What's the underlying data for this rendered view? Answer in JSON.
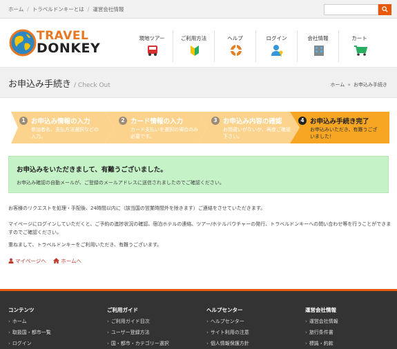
{
  "topbar": {
    "breadcrumbs": [
      "ホーム",
      "トラベルドンキーとは",
      "運営会社情報"
    ],
    "search_placeholder": ""
  },
  "logo": {
    "line1": "TRAVEL",
    "line2": "DONKEY"
  },
  "nav": {
    "items": [
      {
        "label": "現地ツアー",
        "icon": "bus-icon"
      },
      {
        "label": "ご利用方法",
        "icon": "beginner-mark-icon"
      },
      {
        "label": "ヘルプ",
        "icon": "lifebuoy-icon"
      },
      {
        "label": "ログイン",
        "icon": "user-key-icon"
      },
      {
        "label": "会社情報",
        "icon": "building-icon"
      },
      {
        "label": "カート",
        "icon": "cart-icon"
      }
    ]
  },
  "page": {
    "title": "お申込み手続き",
    "subtitle": "/ Check Out",
    "crumb_home": "ホーム",
    "crumb_current": "お申込み手続き"
  },
  "steps": [
    {
      "num": "1",
      "title": "お申込み情報の入力",
      "desc": "参加者名、支払方法選択などの入力。",
      "active": false
    },
    {
      "num": "2",
      "title": "カード情報の入力",
      "desc": "カード支払いを選択の場合のみ必要です。",
      "active": false
    },
    {
      "num": "3",
      "title": "お申込み内容の確認",
      "desc": "お間違いがないか、再度ご確認下さい。",
      "active": false
    },
    {
      "num": "4",
      "title": "お申込み手続き完了",
      "desc": "お申込みいただき、有難うございました！",
      "active": true
    }
  ],
  "success": {
    "title": "お申込みをいただきまして、有難うございました。",
    "text": "お申込み確認の自動メールが、ご登録のメールアドレスに送信されましたのでご確認ください。"
  },
  "body": {
    "para1": "お客様のリクエストを処理・手配後、24時間以内に（該当国の営業時間外を除きます）ご連絡をさせていただきます。",
    "para2": "マイページにログインしていただくと、ご予約の進捗状況の確認、宿泊ホテルの連絡、ツアー/ホテルバウチャーの発行、トラベルドンキーへの問い合わせ等を行うことができますのでご確認ください。",
    "para3": "重ねまして、トラベルドンキーをご利用いただき、有難うございます。",
    "link_mypage": "マイページへ",
    "link_home": "ホームへ"
  },
  "footer": {
    "columns": [
      {
        "heading": "コンテンツ",
        "items": [
          "ホーム",
          "取扱国・都市一覧",
          "ログイン"
        ]
      },
      {
        "heading": "ご利用ガイド",
        "items": [
          "ご利用ガイド目次",
          "ユーザー登録方法",
          "国・都市・カテゴリー選択"
        ]
      },
      {
        "heading": "ヘルプセンター",
        "items": [
          "ヘルプセンター",
          "サイト利用の注意",
          "個人情報保護方針"
        ]
      },
      {
        "heading": "運営会社情報",
        "items": [
          "運営会社情報",
          "旅行条件書",
          "標識・約款"
        ]
      }
    ]
  },
  "colors": {
    "accent": "#e8590c",
    "step_inactive": "#fbd38d",
    "step_active": "#f6a623",
    "success_bg": "#c5f3c7",
    "footer_bg": "#333333",
    "link": "#c0392b"
  }
}
